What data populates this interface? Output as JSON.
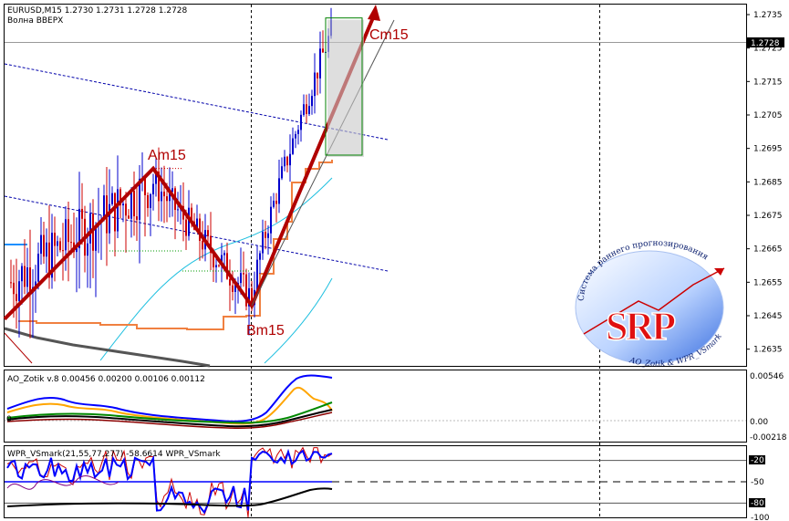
{
  "header": {
    "symbol_line": "EURUSD,M15  1.2730 1.2731 1.2728 1.2728",
    "subtitle": "Волна ВВЕРХ"
  },
  "annotations": {
    "am": "Am15",
    "bm": "Bm15",
    "cm": "Cm15"
  },
  "current_price_label": "1.2728",
  "logo": {
    "big": "SRP",
    "ring_top": "Система раннего прогнозирования",
    "ring_bottom": "AO_Zotik & WPR_VSmark"
  },
  "ao_panel": {
    "title": "AO_Zotik v.8 0.00456 0.00200 0.00106 0.00112",
    "left_marker": "0",
    "ticks": [
      "0.00546",
      "0.00",
      "-0.00218"
    ]
  },
  "wpr_panel": {
    "title": "WPR_VSmark(21,55,77,277) -58.6614  WPR_VSmark",
    "ticks": [
      "-20",
      "-50",
      "-80",
      "-100"
    ]
  },
  "colors": {
    "bull_candle": "#0000cc",
    "bear_candle": "#cc0000",
    "wave_arrow": "#b00000",
    "support_line": "#f08040",
    "trend_dashed": "#0000aa",
    "ao_blue": "#0000ff",
    "ao_orange": "#ffa500",
    "wpr_blue": "#0000ff",
    "wpr_red": "#cc0000"
  },
  "chart_data": {
    "type": "candlestick",
    "title": "EURUSD,M15",
    "ylabel": "",
    "ylim": [
      1.263,
      1.2738
    ],
    "price_ticks": [
      1.2735,
      1.2725,
      1.2715,
      1.2705,
      1.2695,
      1.2685,
      1.2675,
      1.2665,
      1.2655,
      1.2645,
      1.2635
    ],
    "current_price": 1.2728,
    "wave_points": [
      {
        "name": "Am15",
        "price": 1.2689
      },
      {
        "name": "Bm15",
        "price": 1.2648
      },
      {
        "name": "Cm15",
        "price": 1.2738
      }
    ],
    "target_box": {
      "price_high": 1.2734,
      "price_low": 1.2693
    },
    "ao_series_last": {
      "ao": 0.00456,
      "line2": 0.002,
      "line3": 0.00106,
      "line4": 0.00112
    },
    "wpr_last": -58.6614,
    "wpr_levels": [
      -20,
      -50,
      -80,
      -100
    ]
  }
}
